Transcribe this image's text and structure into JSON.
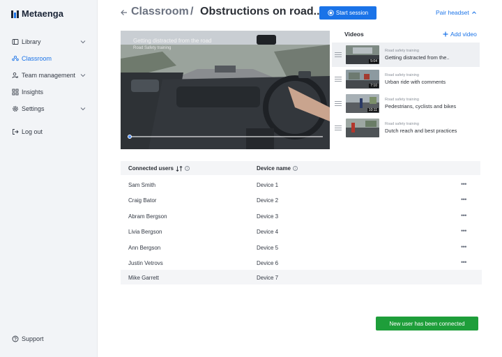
{
  "brand": {
    "name": "Metaenga",
    "color": "#1a73e8"
  },
  "sidebar": {
    "items": [
      {
        "label": "Library",
        "icon": "library-icon",
        "has_chevron": true,
        "active": false
      },
      {
        "label": "Classroom",
        "icon": "classroom-icon",
        "has_chevron": false,
        "active": true
      },
      {
        "label": "Team management",
        "icon": "team-icon",
        "has_chevron": true,
        "active": false
      },
      {
        "label": "Insights",
        "icon": "insights-icon",
        "has_chevron": false,
        "active": false
      },
      {
        "label": "Settings",
        "icon": "gear-icon",
        "has_chevron": true,
        "active": false
      }
    ],
    "logout_label": "Log out",
    "support_label": "Support"
  },
  "header": {
    "parent": "Classroom",
    "separator": "/",
    "title": "Obstructions on road..",
    "start_session_label": "Start session",
    "pair_headset_label": "Pair headset"
  },
  "player": {
    "title": "Getting distracted from the road",
    "subtitle": "Road Safety training",
    "progress": 0.0
  },
  "videos": {
    "heading": "Videos",
    "add_label": "Add video",
    "items": [
      {
        "category": "Road safety training",
        "title": "Getting distracted from the..",
        "duration": "5:04",
        "selected": true
      },
      {
        "category": "Road safety training",
        "title": "Urban ride with comments",
        "duration": "7:10",
        "selected": false
      },
      {
        "category": "Road safety training",
        "title": "Pedestrians, cyclists and bikes",
        "duration": "10:11",
        "selected": false
      },
      {
        "category": "Road safety training",
        "title": "Dutch reach and best practices",
        "duration": "",
        "selected": false
      }
    ]
  },
  "users_table": {
    "col_user": "Connected users",
    "col_device": "Device name",
    "rows": [
      {
        "user": "Sam Smith",
        "device": "Device 1",
        "has_menu": true
      },
      {
        "user": "Craig Bator",
        "device": "Device 2",
        "has_menu": true
      },
      {
        "user": "Abram Bergson",
        "device": "Device 3",
        "has_menu": true
      },
      {
        "user": "Livia Bergson",
        "device": "Device 4",
        "has_menu": true
      },
      {
        "user": "Ann Bergson",
        "device": "Device 5",
        "has_menu": true
      },
      {
        "user": "Justin Vetrovs",
        "device": "Device 6",
        "has_menu": true
      },
      {
        "user": "Mike Garrett",
        "device": "Device 7",
        "has_menu": false
      }
    ],
    "menu_glyph": "•••"
  },
  "toast": {
    "message": "New user has been connected",
    "color": "#1e9e3a"
  }
}
